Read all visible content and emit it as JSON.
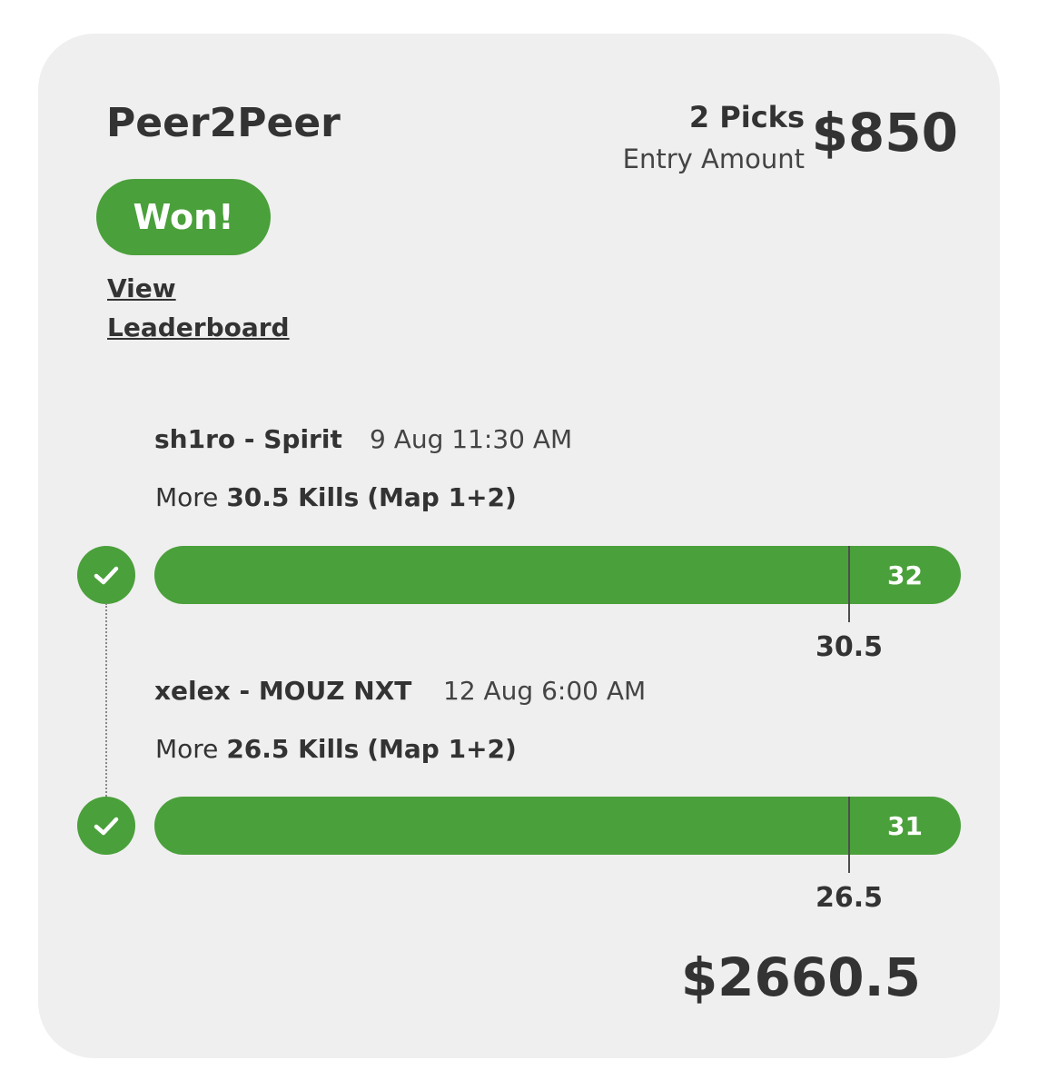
{
  "header": {
    "title": "Peer2Peer",
    "status": "Won!",
    "view_leaderboard": "View Leaderboard",
    "picks": "2 Picks",
    "entry_label": "Entry Amount",
    "entry_amount": "$850"
  },
  "picks": [
    {
      "player": "sh1ro - Spirit",
      "time": "9 Aug 11:30 AM",
      "direction": "More",
      "line": "30.5 Kills",
      "scope": "(Map 1+2)",
      "result": "32",
      "threshold": "30.5",
      "status": "won"
    },
    {
      "player": "xelex - MOUZ NXT",
      "time": "12 Aug 6:00 AM",
      "direction": "More",
      "line": "26.5 Kills",
      "scope": "(Map 1+2)",
      "result": "31",
      "threshold": "26.5",
      "status": "won"
    }
  ],
  "payout": "$2660.5",
  "colors": {
    "accent": "#4aa03a",
    "card_bg": "#efefef",
    "text": "#333333"
  },
  "icons": {
    "pick_status": "check-circle-icon"
  }
}
